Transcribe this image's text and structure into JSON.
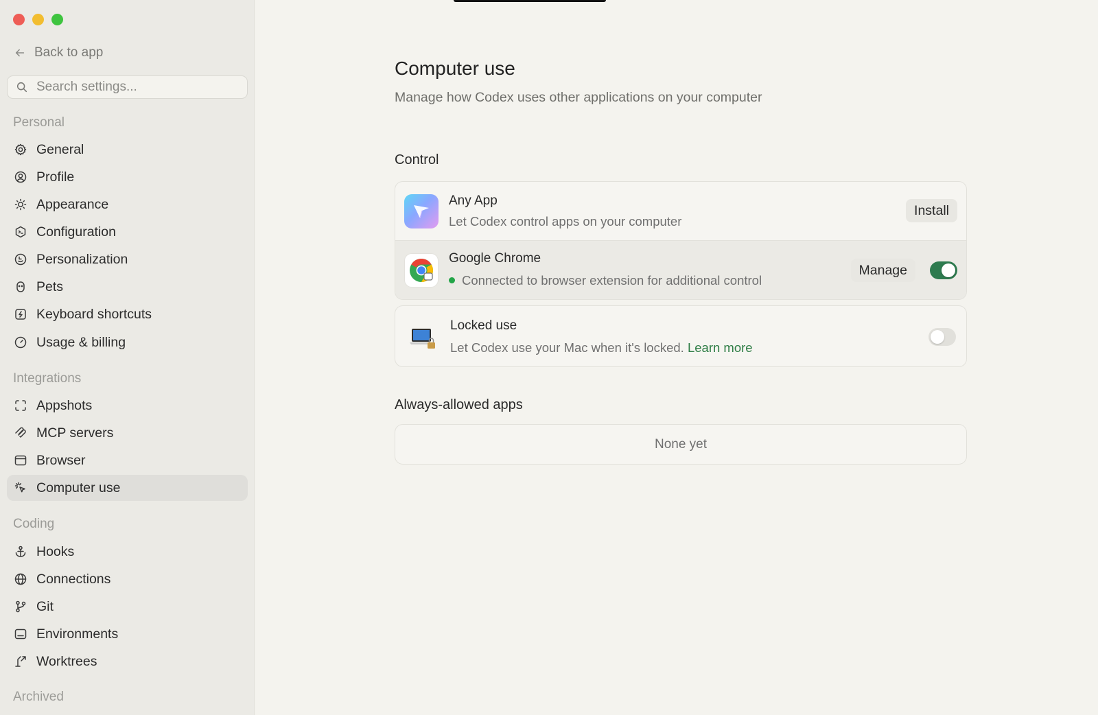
{
  "sidebar": {
    "back_label": "Back to app",
    "search_placeholder": "Search settings...",
    "sections": {
      "personal": "Personal",
      "integrations": "Integrations",
      "coding": "Coding",
      "archived": "Archived"
    },
    "items": {
      "general": "General",
      "profile": "Profile",
      "appearance": "Appearance",
      "configuration": "Configuration",
      "personalization": "Personalization",
      "pets": "Pets",
      "keyboard_shortcuts": "Keyboard shortcuts",
      "usage_billing": "Usage & billing",
      "appshots": "Appshots",
      "mcp_servers": "MCP servers",
      "browser": "Browser",
      "computer_use": "Computer use",
      "hooks": "Hooks",
      "connections": "Connections",
      "git": "Git",
      "environments": "Environments",
      "worktrees": "Worktrees"
    },
    "active_item": "computer_use"
  },
  "main": {
    "title": "Computer use",
    "subtitle": "Manage how Codex uses other applications on your computer",
    "control": {
      "heading": "Control",
      "any_app": {
        "title": "Any App",
        "description": "Let Codex control apps on your computer",
        "button": "Install"
      },
      "chrome": {
        "title": "Google Chrome",
        "status": "Connected to browser extension for additional control",
        "status_color": "#23a548",
        "button": "Manage",
        "enabled": true
      }
    },
    "locked_use": {
      "title": "Locked use",
      "description": "Let Codex use your Mac when it's locked.",
      "link": "Learn more",
      "enabled": false
    },
    "always_allowed": {
      "heading": "Always-allowed apps",
      "empty": "None yet"
    }
  },
  "colors": {
    "accent": "#2e7b4f",
    "link": "#2e7d45",
    "background": "#f4f3ee",
    "sidebar": "#ebeae5"
  }
}
